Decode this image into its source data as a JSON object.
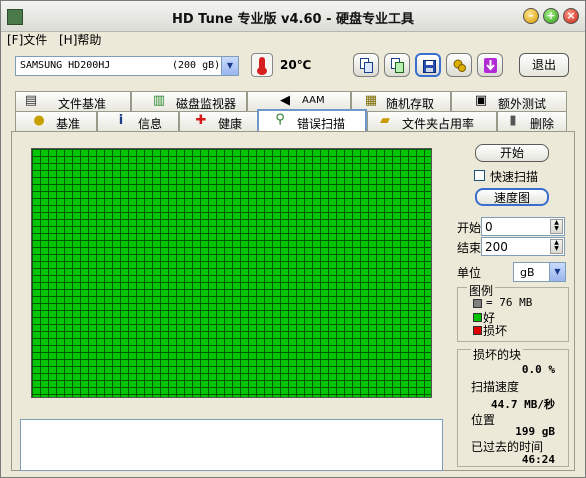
{
  "window": {
    "title": "HD Tune 专业版 v4.60 - 硬盘专业工具",
    "minimize_glyph": "–",
    "maximize_glyph": "+",
    "close_glyph": "×"
  },
  "menu": {
    "file": "[F]文件",
    "help": "[H]帮助"
  },
  "toolbar": {
    "drive_name": "SAMSUNG HD200HJ",
    "drive_size": "(200 gB)",
    "temperature": "20℃",
    "exit_label": "退出",
    "icons": [
      "copy-info-icon",
      "copy-all-icon",
      "save-icon",
      "options-icon",
      "download-icon"
    ]
  },
  "tabs": {
    "row1": [
      {
        "label": "文件基准",
        "icon": "file-benchmark-icon"
      },
      {
        "label": "磁盘监视器",
        "icon": "disk-monitor-icon"
      },
      {
        "label": "AAM",
        "icon": "speaker-icon"
      },
      {
        "label": "随机存取",
        "icon": "random-access-icon"
      },
      {
        "label": "额外测试",
        "icon": "extra-tests-icon"
      }
    ],
    "row2": [
      {
        "label": "基准",
        "icon": "benchmark-icon"
      },
      {
        "label": "信息",
        "icon": "info-icon"
      },
      {
        "label": "健康",
        "icon": "health-icon"
      },
      {
        "label": "错误扫描",
        "icon": "magnifier-icon",
        "active": true
      },
      {
        "label": "文件夹占用率",
        "icon": "folder-icon"
      },
      {
        "label": "删除",
        "icon": "trash-icon"
      }
    ]
  },
  "scan": {
    "start_button": "开始",
    "quick_scan_label": "快速扫描",
    "quick_scan_checked": false,
    "speed_map_button": "速度图",
    "start_label": "开始",
    "start_value": "0",
    "end_label": "结束",
    "end_value": "200",
    "unit_label": "单位",
    "unit_value": "gB"
  },
  "legend": {
    "title": "图例",
    "block_size": "= 76 MB",
    "good": "好",
    "bad": "损坏",
    "colors": {
      "block": "#808080",
      "good": "#00c000",
      "bad": "#e00000"
    }
  },
  "stats": {
    "damaged_label": "损坏的块",
    "damaged_value": "0.0 %",
    "speed_label": "扫描速度",
    "speed_value": "44.7 MB/秒",
    "position_label": "位置",
    "position_value": "199 gB",
    "elapsed_label": "已过去的时间",
    "elapsed_value": "46:24"
  },
  "colors": {
    "good_block": "#04c404",
    "grid_line": "#005a00",
    "active_tab_border": "#6e98c8"
  }
}
